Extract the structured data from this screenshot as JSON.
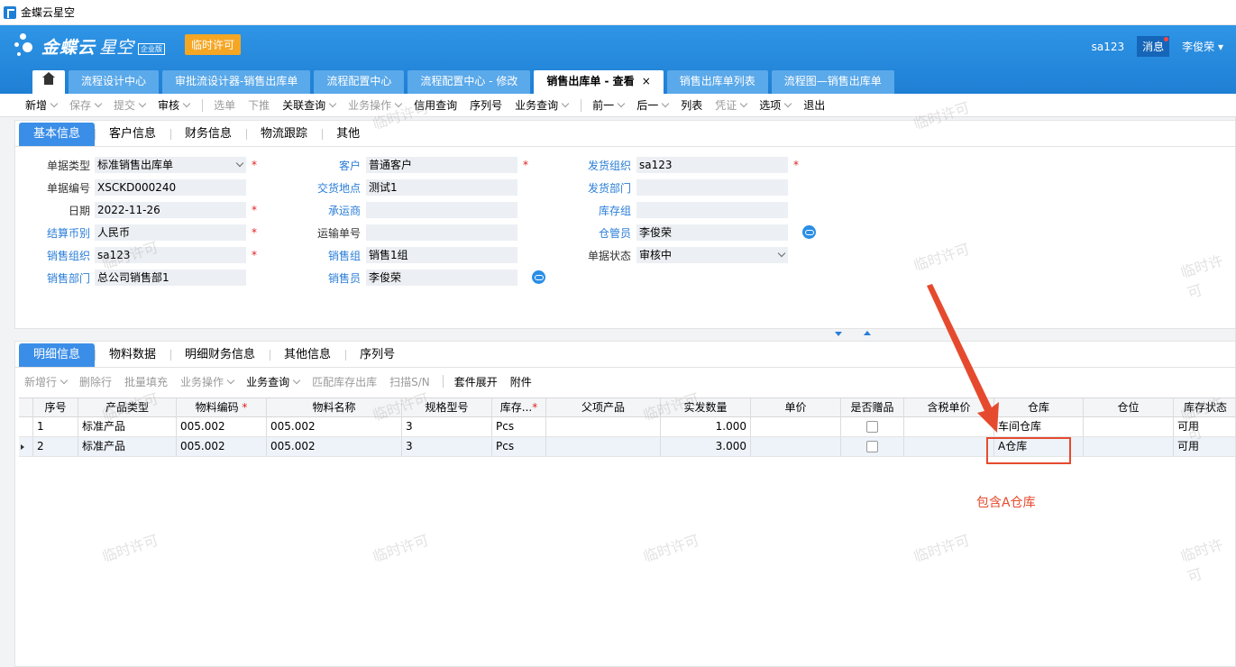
{
  "window": {
    "title": "金蝶云星空"
  },
  "header": {
    "brand": "金蝶云",
    "brand2": "星空",
    "edition": "企业版",
    "temp_license": "临时许可",
    "user_account": "sa123",
    "messages": "消息",
    "user_name": "李俊荣"
  },
  "tabs": [
    {
      "label": "流程设计中心"
    },
    {
      "label": "审批流设计器-销售出库单"
    },
    {
      "label": "流程配置中心"
    },
    {
      "label": "流程配置中心 - 修改"
    },
    {
      "label": "销售出库单 - 查看",
      "close": "×"
    },
    {
      "label": "销售出库单列表"
    },
    {
      "label": "流程图—销售出库单"
    }
  ],
  "toolbar": {
    "new": "新增",
    "save": "保存",
    "submit": "提交",
    "audit": "审核",
    "select": "选单",
    "push": "下推",
    "linked_query": "关联查询",
    "biz_op": "业务操作",
    "credit_query": "信用查询",
    "serial": "序列号",
    "biz_query": "业务查询",
    "prev": "前一",
    "next": "后一",
    "list": "列表",
    "voucher": "凭证",
    "options": "选项",
    "exit": "退出"
  },
  "top_tabs": [
    "基本信息",
    "客户信息",
    "财务信息",
    "物流跟踪",
    "其他"
  ],
  "form": {
    "bill_type_label": "单据类型",
    "bill_type": "标准销售出库单",
    "bill_no_label": "单据编号",
    "bill_no": "XSCKD000240",
    "date_label": "日期",
    "date": "2022-11-26",
    "currency_label": "结算币别",
    "currency": "人民币",
    "sale_org_label": "销售组织",
    "sale_org": "sa123",
    "sale_dept_label": "销售部门",
    "sale_dept": "总公司销售部1",
    "customer_label": "客户",
    "customer": "普通客户",
    "delivery_place_label": "交货地点",
    "delivery_place": "测试1",
    "carrier_label": "承运商",
    "carrier": "",
    "transport_no_label": "运输单号",
    "transport_no": "",
    "sale_group_label": "销售组",
    "sale_group": "销售1组",
    "salesman_label": "销售员",
    "salesman": "李俊荣",
    "ship_org_label": "发货组织",
    "ship_org": "sa123",
    "ship_dept_label": "发货部门",
    "ship_dept": "",
    "stock_group_label": "库存组",
    "stock_group": "",
    "keeper_label": "仓管员",
    "keeper": "李俊荣",
    "status_label": "单据状态",
    "status": "审核中"
  },
  "detail_tabs": [
    "明细信息",
    "物料数据",
    "明细财务信息",
    "其他信息",
    "序列号"
  ],
  "detail_toolbar": {
    "add_row": "新增行",
    "del_row": "删除行",
    "batch_fill": "批量填充",
    "biz_op": "业务操作",
    "biz_query": "业务查询",
    "match_stock": "匹配库存出库",
    "scan_sn": "扫描S/N",
    "kit_expand": "套件展开",
    "attachment": "附件"
  },
  "grid": {
    "columns": [
      "序号",
      "产品类型",
      "物料编码",
      "物料名称",
      "规格型号",
      "库存...",
      "父项产品",
      "实发数量",
      "单价",
      "是否赠品",
      "含税单价",
      "仓库",
      "仓位",
      "库存状态"
    ],
    "rows": [
      {
        "seq": "1",
        "ptype": "标准产品",
        "code": "005.002",
        "name": "005.002",
        "spec": "3",
        "unit": "Pcs",
        "parent": "",
        "qty": "1.000",
        "price": "",
        "tax_price": "",
        "warehouse": "车间仓库",
        "bin": "",
        "stock_status": "可用"
      },
      {
        "seq": "2",
        "ptype": "标准产品",
        "code": "005.002",
        "name": "005.002",
        "spec": "3",
        "unit": "Pcs",
        "parent": "",
        "qty": "3.000",
        "price": "",
        "tax_price": "",
        "warehouse": "A仓库",
        "bin": "",
        "stock_status": "可用"
      }
    ]
  },
  "annotation": {
    "text": "包含A仓库",
    "color": "#e64a2e"
  },
  "watermark": "临时许可",
  "colors": {
    "header": "#2389dc",
    "accent": "#3b8ee8",
    "license": "#f5a623"
  }
}
